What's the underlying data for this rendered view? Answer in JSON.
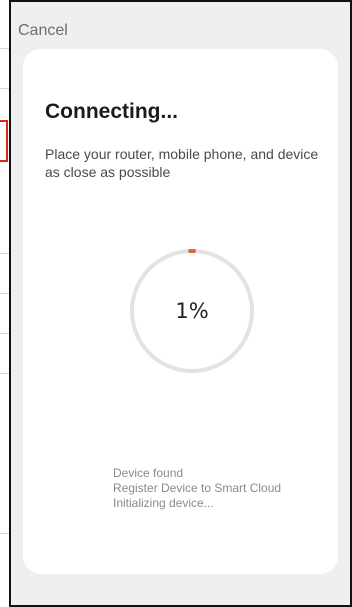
{
  "header": {
    "cancel_label": "Cancel"
  },
  "card": {
    "title": "Connecting...",
    "subtitle": "Place your router, mobile phone, and device as close as possible",
    "progress": {
      "value": 0.01,
      "label": "1%",
      "track_color": "#e3e3e3",
      "fill_color": "#e8643a"
    },
    "steps": [
      "Device found",
      "Register Device to Smart Cloud",
      "Initializing device..."
    ]
  }
}
